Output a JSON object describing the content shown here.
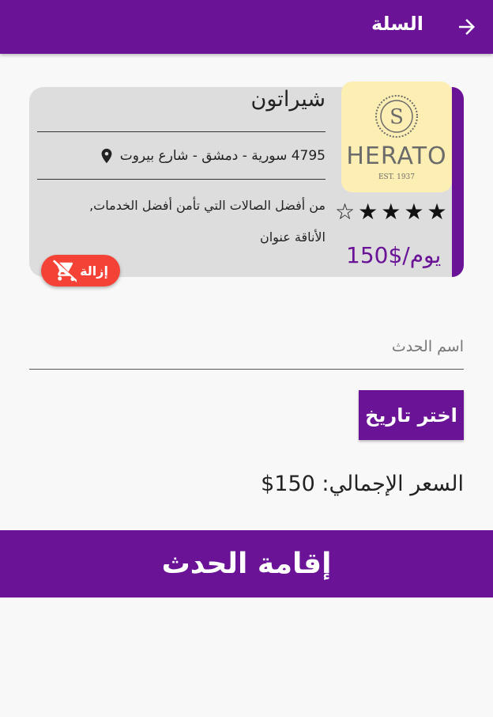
{
  "header": {
    "title": "السلة",
    "back_icon": "arrow-forward-icon"
  },
  "cart_item": {
    "name": "شيراتون",
    "address": "4795 سورية - دمشق - شارع بيروت",
    "description": "من أفضل الصالات التي تأمن أفضل الخدمات, الأناقة عنوان",
    "rating": 4,
    "rating_max": 5,
    "price": "150$/يوم",
    "remove_label": "إزالة",
    "logo": {
      "letter": "S",
      "brand_text": "HERATO",
      "est": "EST. 1937"
    }
  },
  "form": {
    "event_name_placeholder": "اسم الحدث",
    "pick_date_label": "اختر تاريخ"
  },
  "total": "السعر الإجمالي: 150$",
  "submit_label": "إقامة الحدث",
  "colors": {
    "primary": "#6a1397",
    "danger": "#f44336",
    "card_bg": "#dddddd"
  }
}
